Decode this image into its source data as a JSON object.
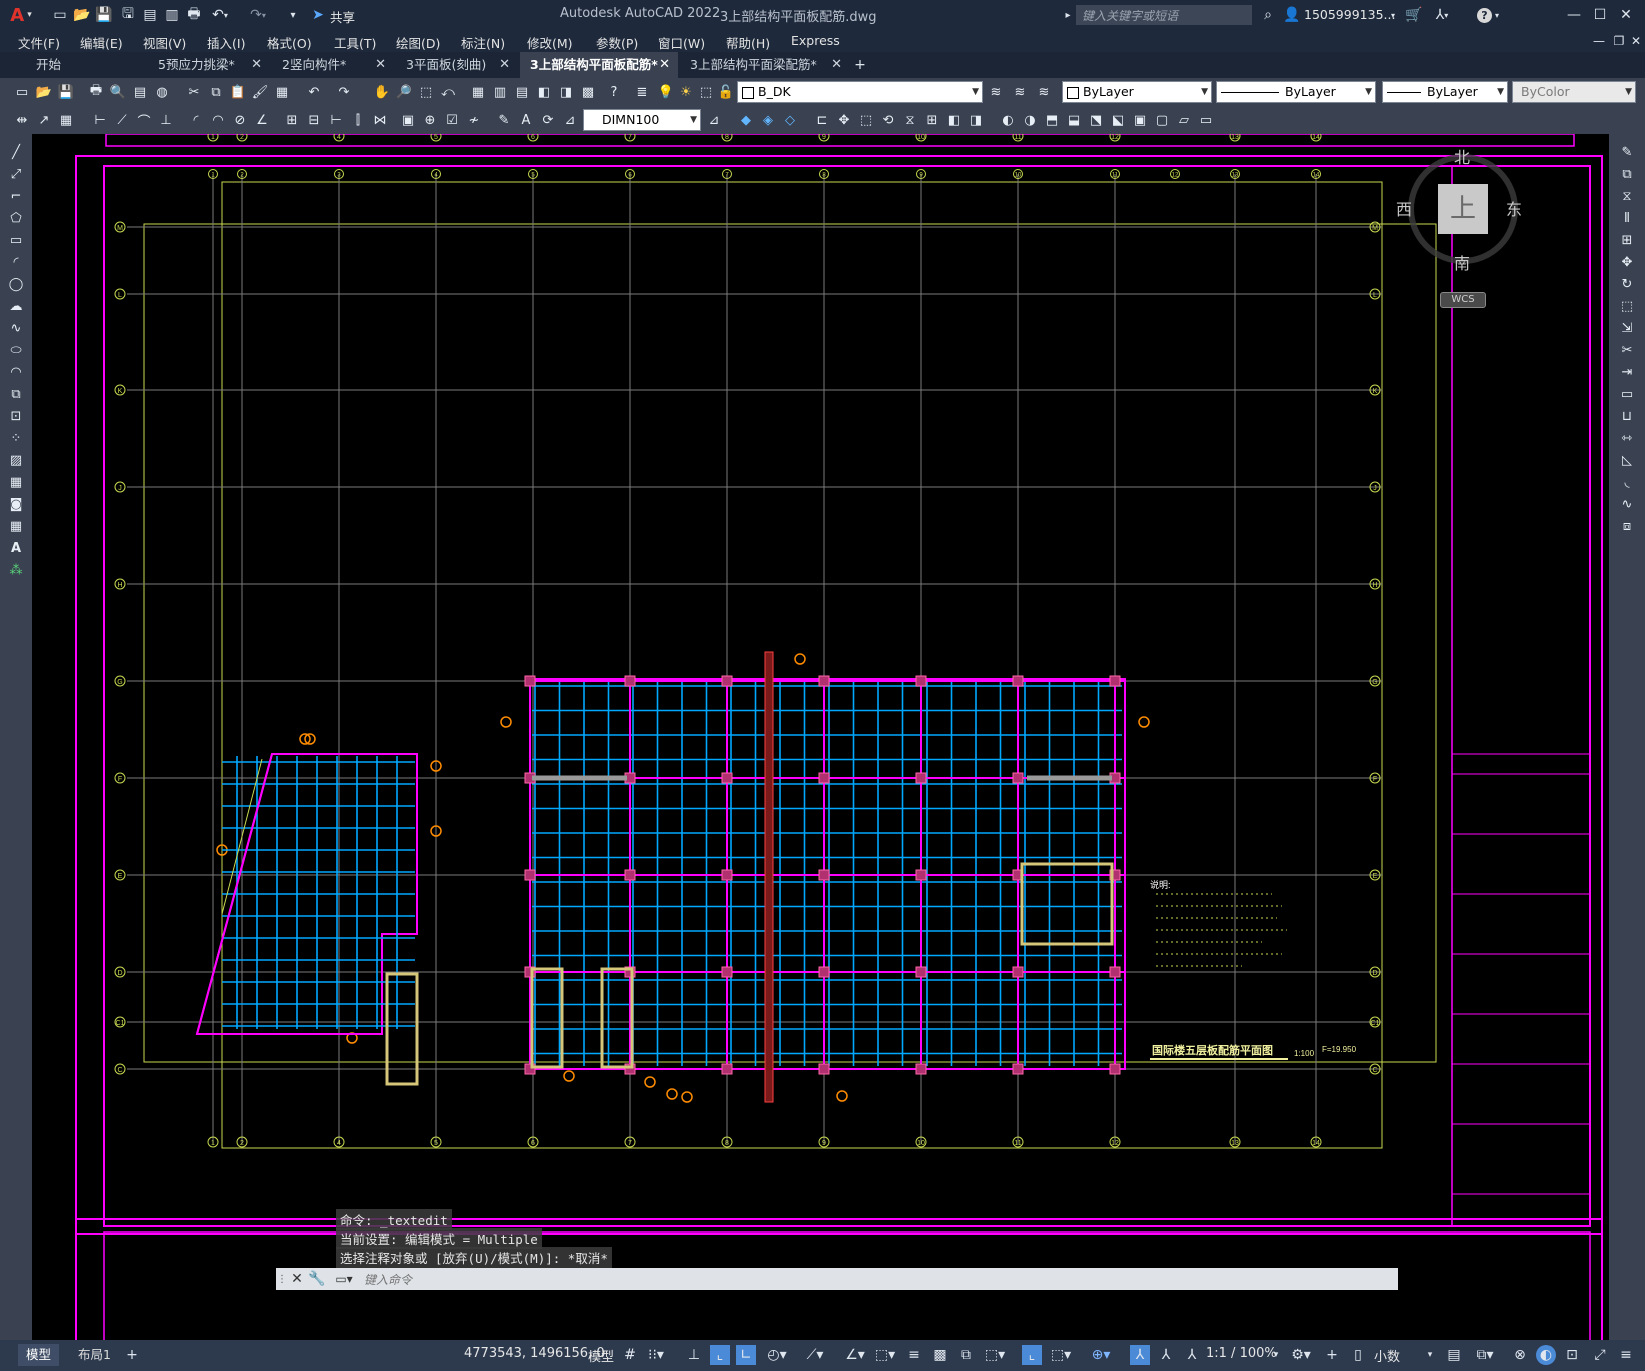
{
  "app": {
    "title": "Autodesk AutoCAD 2022",
    "file": "3上部结构平面板配筋.dwg",
    "logo": "A"
  },
  "title_bar": {
    "share": "共享",
    "search_placeholder": "键入关键字或短语",
    "user": "1505999135...",
    "help": "?"
  },
  "menu": [
    "文件(F)",
    "编辑(E)",
    "视图(V)",
    "插入(I)",
    "格式(O)",
    "工具(T)",
    "绘图(D)",
    "标注(N)",
    "修改(M)",
    "参数(P)",
    "窗口(W)",
    "帮助(H)",
    "Express"
  ],
  "tabs": [
    {
      "label": "开始",
      "active": false,
      "closable": false
    },
    {
      "label": "5预应力挑梁*",
      "active": false,
      "closable": true
    },
    {
      "label": "2竖向构件*",
      "active": false,
      "closable": true
    },
    {
      "label": "3平面板(刻曲)",
      "active": false,
      "closable": true
    },
    {
      "label": "3上部结构平面板配筋*",
      "active": true,
      "closable": true
    },
    {
      "label": "3上部结构平面梁配筋*",
      "active": false,
      "closable": true
    }
  ],
  "tab_add": "+",
  "properties": {
    "layer": "B_DK",
    "color": "ByLayer",
    "linetype": "ByLayer",
    "lineweight": "ByLayer",
    "plotstyle": "ByColor",
    "dimstyle": "DIMN100"
  },
  "viewcube": {
    "north": "北",
    "south": "南",
    "east": "东",
    "west": "西",
    "face": "上",
    "ucs": "WCS"
  },
  "drawing": {
    "grid_top": [
      "1",
      "2",
      "4",
      "5",
      "6",
      "7",
      "8",
      "9",
      "10",
      "11",
      "12",
      "13",
      "14"
    ],
    "grid_top_inner": [
      "1",
      "2",
      "3",
      "4",
      "5",
      "6",
      "7",
      "8",
      "9",
      "10",
      "11",
      "12",
      "13",
      "14"
    ],
    "grid_left": [
      "M",
      "L",
      "K",
      "J",
      "H",
      "G",
      "F",
      "E",
      "D",
      "C1",
      "C"
    ],
    "plan_title": "国际楼五层板配筋平面图",
    "plan_scale": "1:100",
    "plan_elev": "F=19.950",
    "notes_title": "说明:"
  },
  "command": {
    "history": [
      "命令: _textedit",
      "当前设置: 编辑模式 = Multiple",
      "选择注释对象或 [放弃(U)/模式(M)]: *取消*"
    ],
    "placeholder": "键入命令"
  },
  "status": {
    "layout_tabs": [
      "模型",
      "布局1"
    ],
    "coords": "4773543, 1496156, 0",
    "space": "模型",
    "scale": "1:1 / 100%",
    "units": "小数"
  },
  "colors": {
    "magenta": "#ff00ff",
    "yellow_green": "#c8d850",
    "cyan": "#00b4ff",
    "grid": "#7a7a7a",
    "orange": "#ff8c00"
  }
}
